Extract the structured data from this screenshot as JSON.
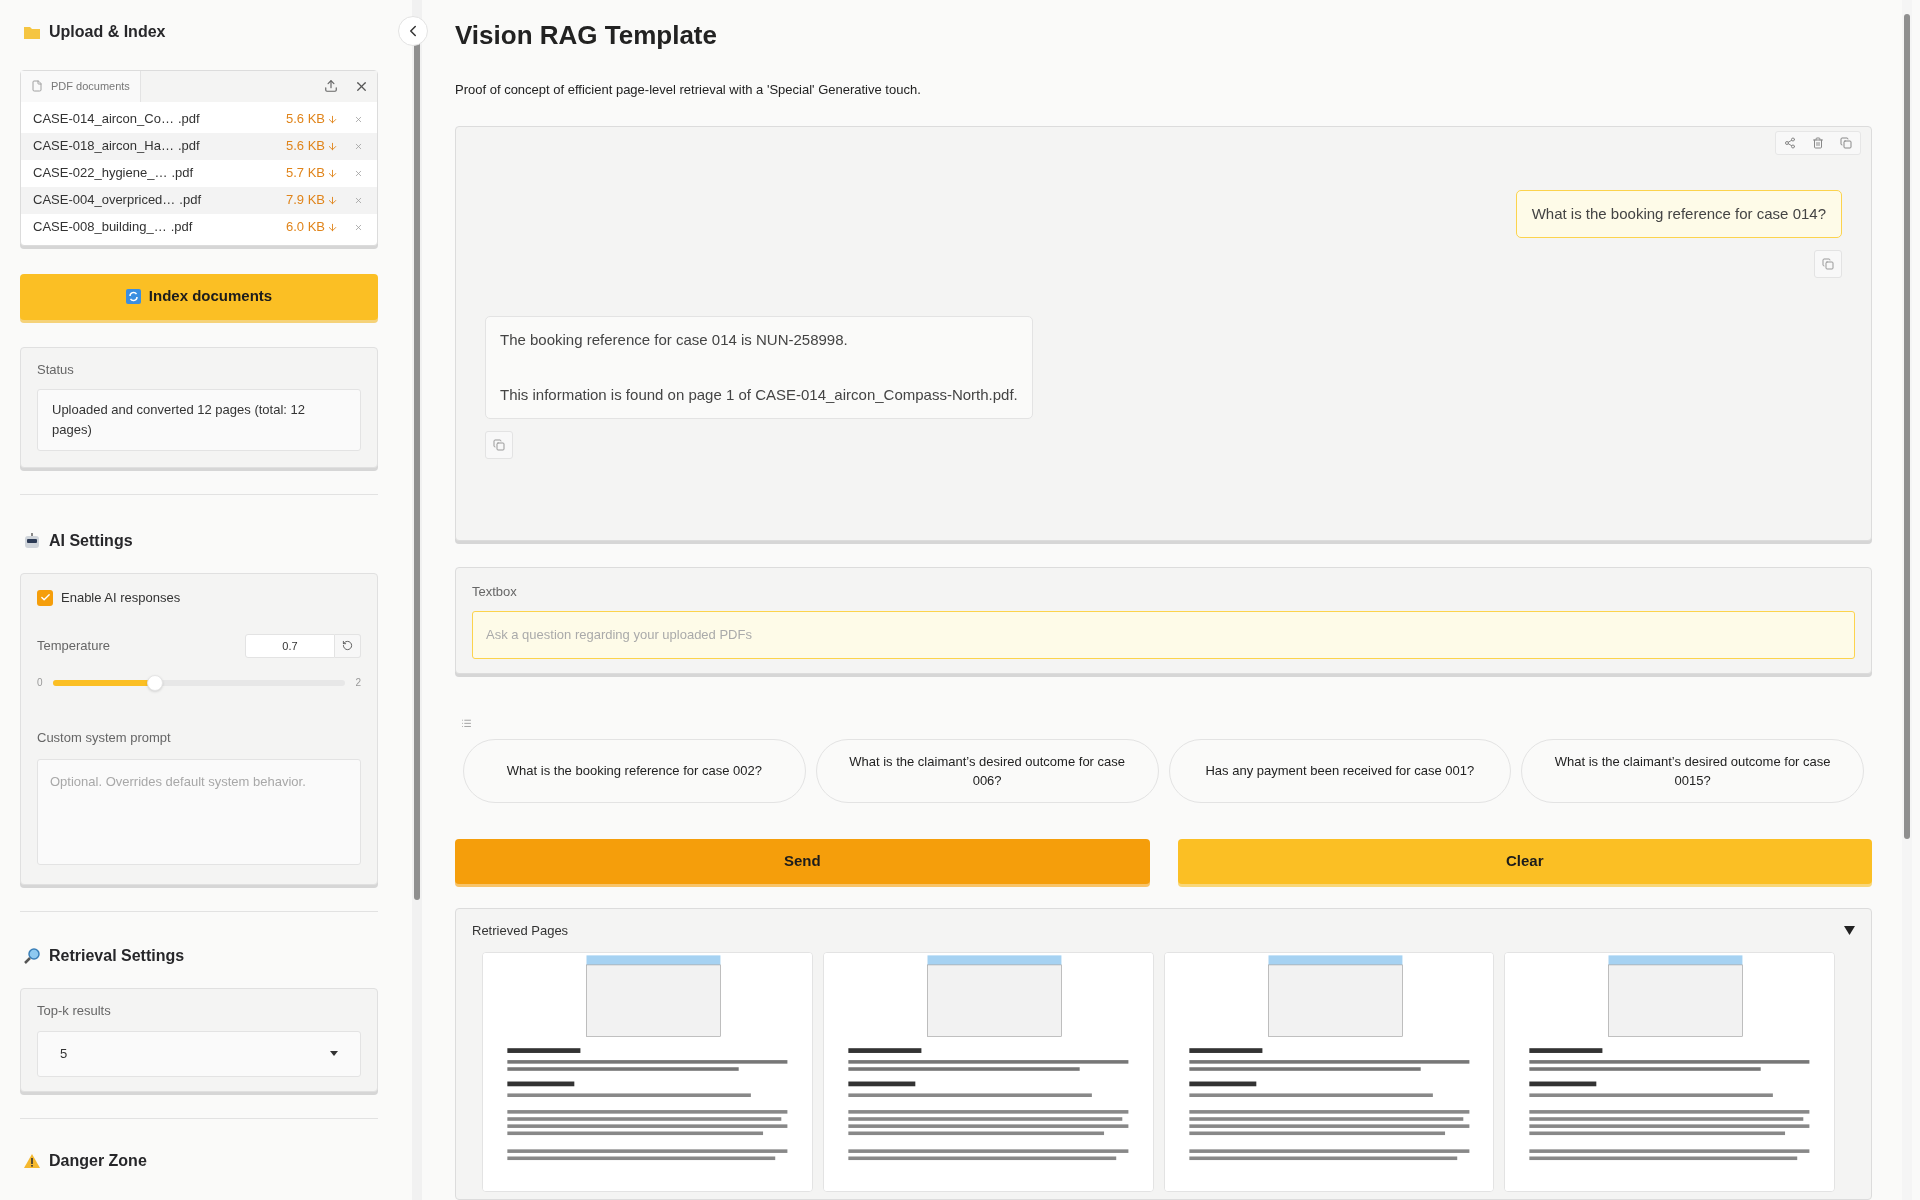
{
  "sidebar": {
    "upload": {
      "title": "Upload & Index",
      "file_tab": "PDF documents",
      "files": [
        {
          "name": "CASE-014_aircon_Co…",
          "ext": ".pdf",
          "size": "5.6 KB"
        },
        {
          "name": "CASE-018_aircon_Ha…",
          "ext": ".pdf",
          "size": "5.6 KB"
        },
        {
          "name": "CASE-022_hygiene_…",
          "ext": ".pdf",
          "size": "5.7 KB"
        },
        {
          "name": "CASE-004_overpriced…",
          "ext": ".pdf",
          "size": "7.9 KB"
        },
        {
          "name": "CASE-008_building_…",
          "ext": ".pdf",
          "size": "6.0 KB"
        }
      ],
      "index_button": "Index documents",
      "status_label": "Status",
      "status_value": "Uploaded and converted 12 pages (total: 12 pages)"
    },
    "ai_settings": {
      "title": "AI Settings",
      "enable_label": "Enable AI responses",
      "enable_checked": true,
      "temperature_label": "Temperature",
      "temperature_value": "0.7",
      "min": "0",
      "max": "2",
      "level": 0.35,
      "prompt_label": "Custom system prompt",
      "prompt_placeholder": "Optional. Overrides default system behavior."
    },
    "retrieval": {
      "title": "Retrieval Settings",
      "top_k_label": "Top-k results",
      "top_k_value": "5"
    },
    "danger": {
      "title": "Danger Zone"
    }
  },
  "main": {
    "title": "Vision RAG Template",
    "subtitle": "Proof of concept of efficient page-level retrieval with a 'Special' Generative touch.",
    "messages": [
      {
        "kind": "user",
        "paragraphs": [
          "What is the booking reference for case 014?"
        ]
      },
      {
        "kind": "bot",
        "paragraphs": [
          "The booking reference for case 014 is NUN-258998.",
          "This information is found on page 1 of CASE-014_aircon_Compass-North.pdf."
        ]
      }
    ],
    "textbox_label": "Textbox",
    "textbox_placeholder": "Ask a question regarding your uploaded PDFs",
    "examples": [
      "What is the booking reference for case 002?",
      "What is the claimant’s desired outcome for case 006?",
      "Has any payment been received for case 001?",
      "What is the claimant’s desired outcome for case 0015?"
    ],
    "send_button": "Send",
    "clear_button": "Clear",
    "retrieved": {
      "title": "Retrieved Pages"
    }
  }
}
